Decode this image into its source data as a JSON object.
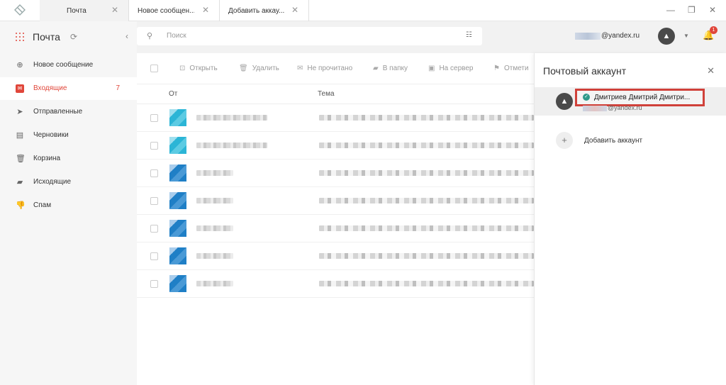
{
  "tabs": [
    {
      "label": "Почта"
    },
    {
      "label": "Новое сообщен..."
    },
    {
      "label": "Добавить аккау..."
    }
  ],
  "window_controls": {
    "minimize": "—",
    "restore": "❐",
    "close": "✕"
  },
  "sidebar": {
    "title": "Почта",
    "items": [
      {
        "label": "Новое сообщение",
        "icon": "plus-square-icon",
        "count": ""
      },
      {
        "label": "Входящие",
        "icon": "inbox-icon",
        "count": "7"
      },
      {
        "label": "Отправленные",
        "icon": "send-icon",
        "count": ""
      },
      {
        "label": "Черновики",
        "icon": "draft-icon",
        "count": ""
      },
      {
        "label": "Корзина",
        "icon": "trash-icon",
        "count": ""
      },
      {
        "label": "Исходящие",
        "icon": "folder-icon",
        "count": ""
      },
      {
        "label": "Спам",
        "icon": "thumbs-down-icon",
        "count": ""
      }
    ]
  },
  "search": {
    "placeholder": "Поиск"
  },
  "account": {
    "email_suffix": "@yandex.ru",
    "notification_count": "1"
  },
  "toolbar": {
    "open": "Открыть",
    "delete": "Удалить",
    "unread": "Не прочитано",
    "to_folder": "В папку",
    "to_server": "На сервер",
    "mark": "Отмети"
  },
  "columns": {
    "from": "От",
    "subject": "Тема"
  },
  "panel": {
    "title": "Почтовый аккаунт",
    "account_name": "Дмитриев Дмитрий Дмитри...",
    "account_email_suffix": "@yandex.ru",
    "add_account": "Добавить аккаунт"
  },
  "colors": {
    "accent": "#e0463a",
    "highlight_border": "#d0413a",
    "sidebar_bg": "#f6f6f6"
  }
}
